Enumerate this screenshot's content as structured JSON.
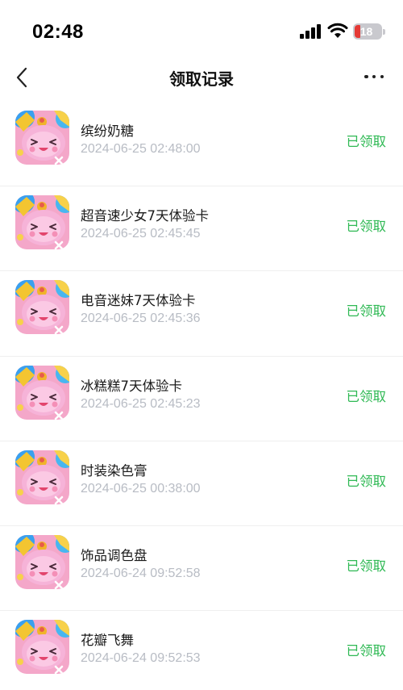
{
  "status_bar": {
    "time": "02:48",
    "battery": "18"
  },
  "nav": {
    "title": "领取记录"
  },
  "records": [
    {
      "name": "缤纷奶糖",
      "time": "2024-06-25 02:48:00",
      "status": "已领取"
    },
    {
      "name": "超音速少女7天体验卡",
      "time": "2024-06-25 02:45:45",
      "status": "已领取"
    },
    {
      "name": "电音迷妹7天体验卡",
      "time": "2024-06-25 02:45:36",
      "status": "已领取"
    },
    {
      "name": "冰糕糕7天体验卡",
      "time": "2024-06-25 02:45:23",
      "status": "已领取"
    },
    {
      "name": "时装染色膏",
      "time": "2024-06-25 00:38:00",
      "status": "已领取"
    },
    {
      "name": "饰品调色盘",
      "time": "2024-06-24 09:52:58",
      "status": "已领取"
    },
    {
      "name": "花瓣飞舞",
      "time": "2024-06-24 09:52:53",
      "status": "已领取"
    }
  ],
  "colors": {
    "status_green": "#2fb954",
    "timestamp_gray": "#b8bcc4",
    "battery_red": "#e53935"
  },
  "icons": [
    "back-chevron-icon",
    "more-dots-icon",
    "signal-icon",
    "wifi-icon",
    "battery-icon",
    "game-app-icon"
  ]
}
